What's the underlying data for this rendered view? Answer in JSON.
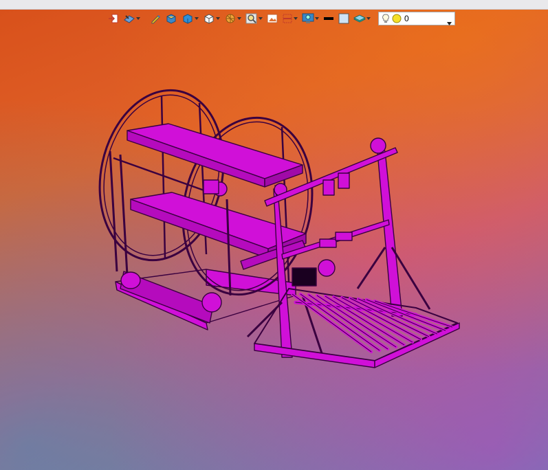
{
  "toolbar": {
    "icons": [
      "exit-icon",
      "render-mode-icon",
      "pencil-icon",
      "box-solid-icon",
      "box-shaded-icon",
      "box-wire-icon",
      "section-icon",
      "zoom-icon",
      "image-icon",
      "clipping-icon",
      "display-icon",
      "line-color-icon",
      "fill-color-icon",
      "layer-icon"
    ],
    "layer_select": {
      "value": "0"
    }
  },
  "colors": {
    "model": "#d010d8",
    "model_edge": "#3a0040",
    "toolbar_bg": "#e9e9ec"
  }
}
